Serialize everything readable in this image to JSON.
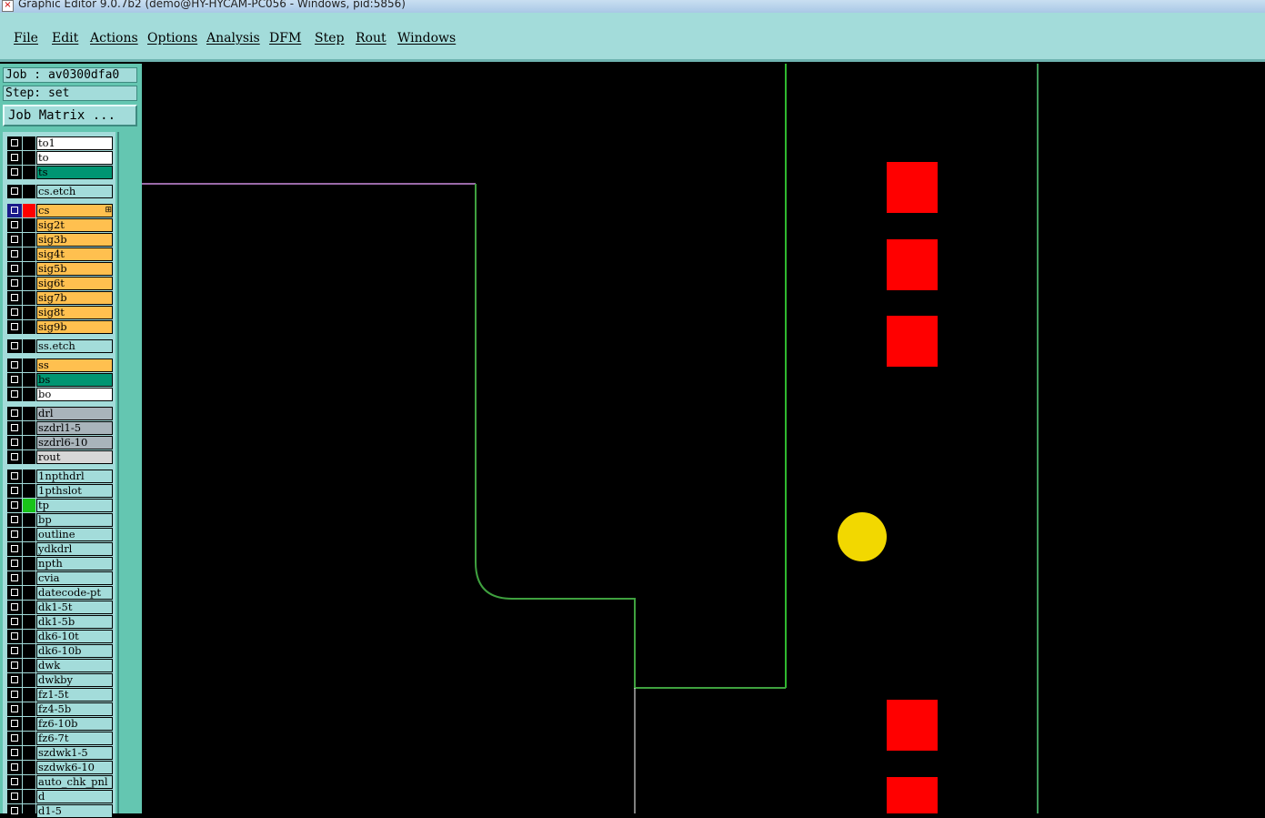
{
  "window": {
    "title": "Graphic Editor 9.0.7b2 (demo@HY-HYCAM-PC056 - Windows, pid:5856)",
    "close_glyph": "×"
  },
  "menu": [
    {
      "label": "File"
    },
    {
      "label": "Edit"
    },
    {
      "label": "Actions"
    },
    {
      "label": "Options"
    },
    {
      "label": "Analysis"
    },
    {
      "label": "DFM"
    },
    {
      "label": "Step"
    },
    {
      "label": "Rout"
    },
    {
      "label": "Windows"
    }
  ],
  "job": {
    "label": "Job : av0300dfa0",
    "step": "Step: set",
    "matrix_button": "Job Matrix ..."
  },
  "colors": {
    "signal": "#ffc04f",
    "mask": "#009572",
    "silk": "#ffffff",
    "drill": "#a9b4bb",
    "rout": "#d7d7d7",
    "misc": "#a3dcda",
    "pad": "#ff0000",
    "via": "#f2d800",
    "outline": "#3fa13f"
  },
  "layers": [
    {
      "name": "to1",
      "type": "silk"
    },
    {
      "name": "to",
      "type": "silk"
    },
    {
      "name": "ts",
      "type": "mask"
    },
    {
      "name": "cs.etch",
      "type": "misc",
      "gap": true
    },
    {
      "name": "cs",
      "type": "signal",
      "gap": true,
      "work": true,
      "marker": "⊞"
    },
    {
      "name": "sig2t",
      "type": "signal"
    },
    {
      "name": "sig3b",
      "type": "signal"
    },
    {
      "name": "sig4t",
      "type": "signal"
    },
    {
      "name": "sig5b",
      "type": "signal"
    },
    {
      "name": "sig6t",
      "type": "signal"
    },
    {
      "name": "sig7b",
      "type": "signal"
    },
    {
      "name": "sig8t",
      "type": "signal"
    },
    {
      "name": "sig9b",
      "type": "signal"
    },
    {
      "name": "ss.etch",
      "type": "misc",
      "gap": true
    },
    {
      "name": "ss",
      "type": "signal",
      "gap": true
    },
    {
      "name": "bs",
      "type": "mask"
    },
    {
      "name": "bo",
      "type": "silk"
    },
    {
      "name": "drl",
      "type": "drill",
      "gap": true
    },
    {
      "name": "szdrl1-5",
      "type": "drill"
    },
    {
      "name": "szdrl6-10",
      "type": "drill"
    },
    {
      "name": "rout",
      "type": "rout"
    },
    {
      "name": "1npthdrl",
      "type": "misc",
      "gap": true
    },
    {
      "name": "1pthslot",
      "type": "misc"
    },
    {
      "name": "tp",
      "type": "misc",
      "affected": true
    },
    {
      "name": "bp",
      "type": "misc"
    },
    {
      "name": "outline",
      "type": "misc"
    },
    {
      "name": "ydkdrl",
      "type": "misc"
    },
    {
      "name": "npth",
      "type": "misc"
    },
    {
      "name": "cvia",
      "type": "misc"
    },
    {
      "name": "datecode-pt",
      "type": "misc"
    },
    {
      "name": "dk1-5t",
      "type": "misc"
    },
    {
      "name": "dk1-5b",
      "type": "misc"
    },
    {
      "name": "dk6-10t",
      "type": "misc"
    },
    {
      "name": "dk6-10b",
      "type": "misc"
    },
    {
      "name": "dwk",
      "type": "misc"
    },
    {
      "name": "dwkby",
      "type": "misc"
    },
    {
      "name": "fz1-5t",
      "type": "misc"
    },
    {
      "name": "fz4-5b",
      "type": "misc"
    },
    {
      "name": "fz6-10b",
      "type": "misc"
    },
    {
      "name": "fz6-7t",
      "type": "misc"
    },
    {
      "name": "szdwk1-5",
      "type": "misc"
    },
    {
      "name": "szdwk6-10",
      "type": "misc"
    },
    {
      "name": "auto_chk_pnl",
      "type": "misc"
    },
    {
      "name": "d",
      "type": "misc"
    },
    {
      "name": "d1-5",
      "type": "misc"
    }
  ]
}
